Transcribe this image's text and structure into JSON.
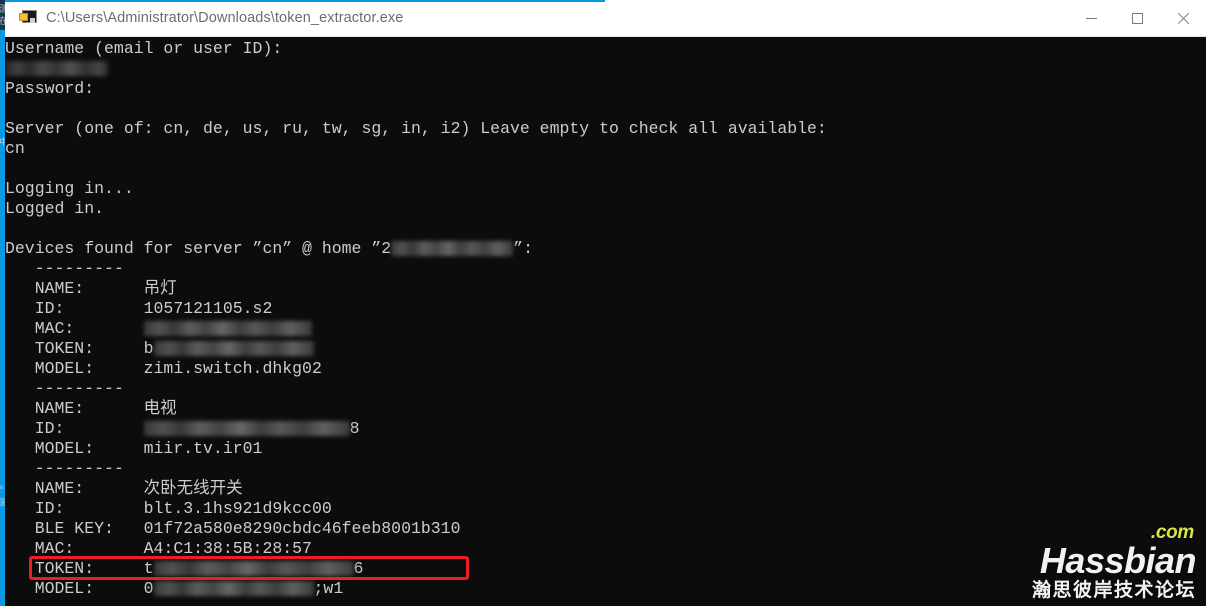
{
  "window": {
    "title": "C:\\Users\\Administrator\\Downloads\\token_extractor.exe",
    "icon": "console-exe-icon",
    "controls": {
      "minimize": "—",
      "maximize": "□",
      "close": "✕"
    },
    "accent_color": "#0a9ae3",
    "titlebar_bg": "#ffffff",
    "titlebar_text_color": "#6d6d6d"
  },
  "desktop": {
    "strip_color": "#0a9ae3",
    "ghost_fragments": [
      "测",
      "在",
      "中",
      "≡",
      "圖"
    ]
  },
  "console": {
    "bg": "#0c0c0c",
    "fg": "#cccccc",
    "lines": [
      {
        "type": "text",
        "text": "Username (email or user ID):"
      },
      {
        "type": "redact",
        "prefix": "",
        "redact_width": 103,
        "suffix": ""
      },
      {
        "type": "text",
        "text": "Password:"
      },
      {
        "type": "blank"
      },
      {
        "type": "text",
        "text": "Server (one of: cn, de, us, ru, tw, sg, in, i2) Leave empty to check all available:"
      },
      {
        "type": "text",
        "text": "cn"
      },
      {
        "type": "blank"
      },
      {
        "type": "text",
        "text": "Logging in..."
      },
      {
        "type": "text",
        "text": "Logged in."
      },
      {
        "type": "blank"
      },
      {
        "type": "redact",
        "prefix": "Devices found for server ”cn” @ home ”2",
        "redact_width": 122,
        "suffix": "”:"
      },
      {
        "type": "text",
        "text": "   ---------"
      },
      {
        "type": "text",
        "text": "   NAME:      吊灯"
      },
      {
        "type": "text",
        "text": "   ID:        1057121105.s2"
      },
      {
        "type": "redact",
        "prefix": "   MAC:       ",
        "redact_width": 168,
        "suffix": ""
      },
      {
        "type": "redact",
        "prefix": "   TOKEN:     b",
        "redact_width": 160,
        "suffix": ""
      },
      {
        "type": "text",
        "text": "   MODEL:     zimi.switch.dhkg02"
      },
      {
        "type": "text",
        "text": "   ---------"
      },
      {
        "type": "text",
        "text": "   NAME:      电视"
      },
      {
        "type": "redact",
        "prefix": "   ID:        ",
        "redact_width": 206,
        "suffix": "8"
      },
      {
        "type": "text",
        "text": "   MODEL:     miir.tv.ir01"
      },
      {
        "type": "text",
        "text": "   ---------"
      },
      {
        "type": "text",
        "text": "   NAME:      次卧无线开关"
      },
      {
        "type": "text",
        "text": "   ID:        blt.3.1hs921d9kcc00"
      },
      {
        "type": "text",
        "text": "   BLE KEY:   01f72a580e8290cbdc46feeb8001b310"
      },
      {
        "type": "text",
        "text": "   MAC:       A4:C1:38:5B:28:57"
      },
      {
        "type": "redact",
        "prefix": "   TOKEN:     t",
        "redact_width": 200,
        "suffix": "6"
      },
      {
        "type": "redact",
        "prefix": "   MODEL:     0",
        "redact_width": 160,
        "suffix": ";w1"
      }
    ]
  },
  "highlight": {
    "label": "BLE KEY",
    "value": "01f72a580e8290cbdc46feeb8001b310",
    "box_color": "#ee1c25"
  },
  "watermark": {
    "brand": "Hassbian",
    "tld": ".com",
    "subtitle": "瀚思彼岸技术论坛",
    "tld_color": "#d6e34a",
    "brand_color": "#f2f2f2"
  }
}
